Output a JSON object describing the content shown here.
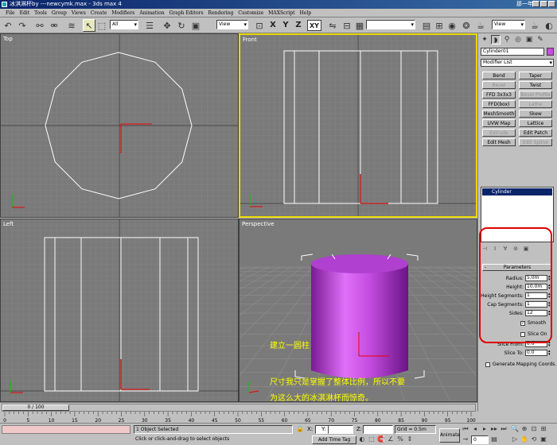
{
  "window": {
    "title": "冰淇淋杯by ---newcymk.max - 3ds max 4",
    "right_text": "那一年"
  },
  "menu": [
    "File",
    "Edit",
    "Tools",
    "Group",
    "Views",
    "Create",
    "Modifiers",
    "Animation",
    "Graph Editors",
    "Rendering",
    "Customize",
    "MAXScript",
    "Help"
  ],
  "toolbar": {
    "selection_filter": "All",
    "coord_system": "View",
    "named_selection": "",
    "constraint_x": "X",
    "constraint_y": "Y",
    "constraint_z": "Z",
    "constraint_xy": "XY",
    "render_view": "View"
  },
  "viewports": {
    "top": "Top",
    "front": "Front",
    "left": "Left",
    "perspective": "Perspective"
  },
  "annotations": {
    "line1": "建立一圆柱",
    "line2": "尺寸我只是掌握了整体比例，所以不要",
    "line3": "为这么大的冰淇淋杯而惊奇。"
  },
  "command_panel": {
    "object_name": "Cylinder01",
    "object_color": "#c84ce0",
    "modifier_list": "Modifier List",
    "buttons": [
      {
        "label": "Bend",
        "enabled": true
      },
      {
        "label": "Taper",
        "enabled": true
      },
      {
        "label": "Bevel",
        "enabled": false
      },
      {
        "label": "Twist",
        "enabled": true
      },
      {
        "label": "FFD 3x3x3",
        "enabled": true
      },
      {
        "label": "Bevel Profile",
        "enabled": false
      },
      {
        "label": "FFD(box)",
        "enabled": true
      },
      {
        "label": "Lathe",
        "enabled": false
      },
      {
        "label": "MeshSmooth",
        "enabled": true
      },
      {
        "label": "Skew",
        "enabled": true
      },
      {
        "label": "UVW Map",
        "enabled": true
      },
      {
        "label": "Lattice",
        "enabled": true
      },
      {
        "label": "Extrude",
        "enabled": false
      },
      {
        "label": "Edit Patch",
        "enabled": true
      },
      {
        "label": "Edit Mesh",
        "enabled": true
      },
      {
        "label": "Edit Spline",
        "enabled": false
      }
    ],
    "stack_item": "Cylinder",
    "parameters": {
      "title": "Parameters",
      "radius_label": "Radius:",
      "radius": "5.0m",
      "height_label": "Height:",
      "height": "10.0m",
      "height_segments_label": "Height Segments:",
      "height_segments": "1",
      "cap_segments_label": "Cap Segments:",
      "cap_segments": "1",
      "sides_label": "Sides:",
      "sides": "12",
      "smooth_label": "Smooth",
      "smooth": true,
      "slice_on_label": "Slice On",
      "slice_on": false,
      "slice_from_label": "Slice From:",
      "slice_from": "0.0",
      "slice_to_label": "Slice To:",
      "slice_to": "0.0",
      "gen_mapping_label": "Generate Mapping Coords.",
      "gen_mapping": false
    }
  },
  "timeline": {
    "frame": "0 / 100",
    "ticks": [
      "0",
      "5",
      "10",
      "15",
      "20",
      "25",
      "30",
      "35",
      "40",
      "45",
      "50",
      "55",
      "60",
      "65",
      "70",
      "75",
      "80",
      "85",
      "90",
      "95",
      "100"
    ]
  },
  "status": {
    "selection": "1 Object Selected",
    "prompt": "Click or click-and-drag to select objects",
    "x_label": "X:",
    "y_label": "Y:",
    "z_label": "Z:",
    "x": "",
    "y": "",
    "z": "",
    "grid": "Grid = 0.5m",
    "add_time_tag": "Add Time Tag",
    "animate": "Animate",
    "current_frame": "0"
  }
}
